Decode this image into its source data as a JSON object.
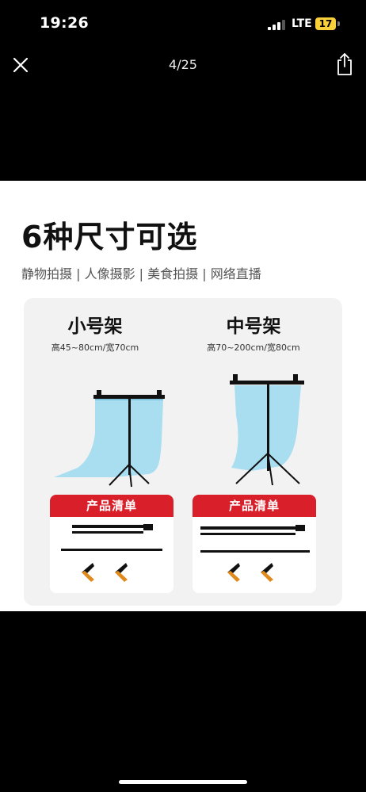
{
  "status_bar": {
    "time": "19:26",
    "network": "LTE",
    "battery": "17"
  },
  "viewer": {
    "page_indicator": "4/25",
    "close_icon": "close-icon",
    "share_icon": "share-icon"
  },
  "image": {
    "headline": "6种尺寸可选",
    "subline": "静物拍摄 | 人像摄影 | 美食拍摄 |  网络直播",
    "columns": [
      {
        "title": "小号架",
        "size": "高45~80cm/宽70cm",
        "list_label": "产品清单"
      },
      {
        "title": "中号架",
        "size": "高70~200cm/宽80cm",
        "list_label": "产品清单"
      }
    ],
    "colors": {
      "backdrop": "#a9def0",
      "header_red": "#d9202a"
    }
  }
}
